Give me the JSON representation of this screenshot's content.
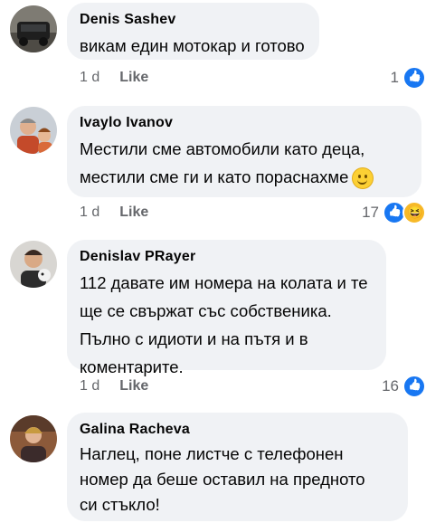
{
  "comments": [
    {
      "author": "Denis Sashev",
      "lines": [
        "викам един мотокар и готово"
      ],
      "time": "1 d",
      "like_label": "Like",
      "reaction_count": "1",
      "reactions": [
        "like"
      ]
    },
    {
      "author": "Ivaylo Ivanov",
      "lines": [
        "Местили сме автомобили като деца,",
        "местили сме ги и като пораснахме"
      ],
      "emoji": "slightly-smiling-face",
      "time": "1 d",
      "like_label": "Like",
      "reaction_count": "17",
      "reactions": [
        "like",
        "haha"
      ]
    },
    {
      "author": "Denislav PRayer",
      "lines": [
        "112 давате им номера на колата и те",
        "ще се свържат със собственика.",
        "Пълно с идиоти и на пътя и в",
        "коментарите."
      ],
      "time": "1 d",
      "like_label": "Like",
      "reaction_count": "16",
      "reactions": [
        "like"
      ]
    },
    {
      "author": "Galina Racheva",
      "lines": [
        "Наглец, поне листче с телефонен",
        "номер да беше оставил на предното",
        "си стъкло!"
      ]
    }
  ],
  "colors": {
    "bubble": "#f0f2f5",
    "meta_text": "#65676b",
    "like_blue": "#1877f2",
    "haha_yellow": "#f7b928"
  }
}
